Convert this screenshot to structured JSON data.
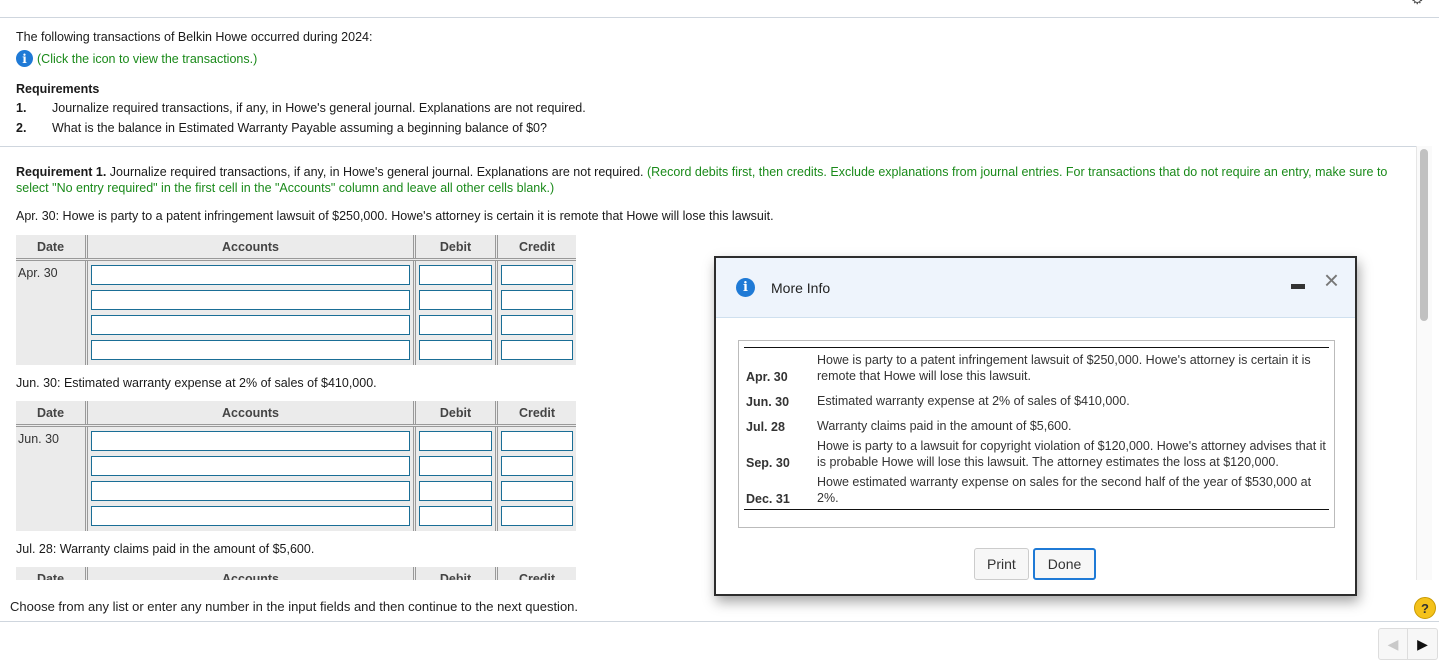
{
  "intro": {
    "line1": "The following transactions of Belkin Howe occurred during 2024:",
    "info_link": "(Click the icon to view the transactions.)",
    "requirements_title": "Requirements",
    "requirements": [
      {
        "num": "1.",
        "text": "Journalize required transactions, if any, in Howe's general journal. Explanations are not required."
      },
      {
        "num": "2.",
        "text": "What is the balance in Estimated Warranty Payable assuming a beginning balance of $0?"
      }
    ]
  },
  "requirement1": {
    "label": "Requirement 1.",
    "text": " Journalize required transactions, if any, in Howe's general journal. Explanations are not required. ",
    "instructions": "(Record debits first, then credits. Exclude explanations from journal entries. For transactions that do not require an entry, make sure to select \"No entry required\" in the first cell in the \"Accounts\" column and leave all other cells blank.)"
  },
  "table_headers": {
    "date": "Date",
    "accounts": "Accounts",
    "debit": "Debit",
    "credit": "Credit"
  },
  "journals": [
    {
      "description": "Apr. 30: Howe is party to a patent infringement lawsuit of $250,000. Howe's attorney is certain it is remote that Howe will lose this lawsuit.",
      "date": "Apr. 30"
    },
    {
      "description": "Jun. 30: Estimated warranty expense at 2% of sales of $410,000.",
      "date": "Jun. 30"
    },
    {
      "description": "Jul. 28: Warranty claims paid in the amount of $5,600.",
      "date": "Jul. 28"
    }
  ],
  "footer": {
    "hint": "Choose from any list or enter any number in the input fields and then continue to the next question.",
    "help": "?",
    "prev": "◀",
    "next": "▶"
  },
  "modal": {
    "title": "More Info",
    "close": "×",
    "rows": [
      {
        "date": "Apr. 30",
        "text": "Howe is party to a patent infringement lawsuit of $250,000. Howe's attorney is certain it is remote that Howe will lose this lawsuit."
      },
      {
        "date": "Jun. 30",
        "text": "Estimated warranty expense at 2% of sales of $410,000."
      },
      {
        "date": "Jul. 28",
        "text": "Warranty claims paid in the amount of $5,600."
      },
      {
        "date": "Sep. 30",
        "text": "Howe is party to a lawsuit for copyright violation of $120,000. Howe's attorney advises that it is probable Howe will lose this lawsuit. The attorney estimates the loss at $120,000."
      },
      {
        "date": "Dec. 31",
        "text": "Howe estimated warranty expense on sales for the second half of the year of $530,000 at 2%."
      }
    ],
    "print_label": "Print",
    "done_label": "Done"
  }
}
